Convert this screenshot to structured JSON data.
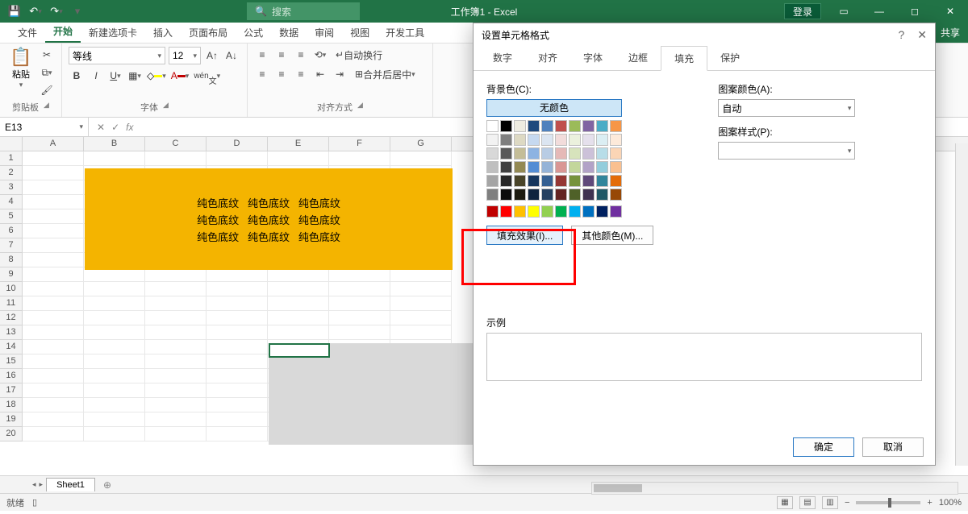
{
  "titlebar": {
    "title": "工作簿1  -  Excel",
    "search_placeholder": "搜索",
    "login": "登录"
  },
  "tabs": {
    "file": "文件",
    "home": "开始",
    "newtab": "新建选项卡",
    "insert": "插入",
    "layout": "页面布局",
    "formula": "公式",
    "data": "数据",
    "review": "审阅",
    "view": "视图",
    "dev": "开发工具",
    "share": "共享"
  },
  "ribbon": {
    "paste": "粘贴",
    "clipboard": "剪贴板",
    "font_name": "等线",
    "font_size": "12",
    "font_group": "字体",
    "wen": "wén",
    "align_group": "对齐方式",
    "wrap": "自动换行",
    "merge": "合并后居中"
  },
  "namebox": "E13",
  "columns": [
    "A",
    "B",
    "C",
    "D",
    "E",
    "F",
    "G"
  ],
  "rows_count": 20,
  "yellow_text": "纯色底纹",
  "sheet": {
    "name": "Sheet1"
  },
  "status": {
    "ready": "就绪",
    "zoom": "100%"
  },
  "dialog": {
    "title": "设置单元格格式",
    "tabs": {
      "number": "数字",
      "align": "对齐",
      "font": "字体",
      "border": "边框",
      "fill": "填充",
      "protect": "保护"
    },
    "bg_label": "背景色(C):",
    "nocolor": "无颜色",
    "fill_effect": "填充效果(I)...",
    "more_colors": "其他颜色(M)...",
    "pattern_color": "图案颜色(A):",
    "auto": "自动",
    "pattern_style": "图案样式(P):",
    "sample": "示例",
    "ok": "确定",
    "cancel": "取消"
  },
  "palette_main": [
    [
      "#ffffff",
      "#000000",
      "#eeece1",
      "#1f497d",
      "#4f81bd",
      "#c0504d",
      "#9bbb59",
      "#8064a2",
      "#4bacc6",
      "#f79646"
    ],
    [
      "#f2f2f2",
      "#7f7f7f",
      "#ddd9c3",
      "#c6d9f0",
      "#dbe5f1",
      "#f2dcdb",
      "#ebf1dd",
      "#e5e0ec",
      "#dbeef3",
      "#fdeada"
    ],
    [
      "#d8d8d8",
      "#595959",
      "#c4bd97",
      "#8db3e2",
      "#b8cce4",
      "#e5b9b7",
      "#d7e3bc",
      "#ccc1d9",
      "#b7dde8",
      "#fbd5b5"
    ],
    [
      "#bfbfbf",
      "#3f3f3f",
      "#938953",
      "#548dd4",
      "#95b3d7",
      "#d99694",
      "#c3d69b",
      "#b2a2c7",
      "#92cddc",
      "#fac08f"
    ],
    [
      "#a5a5a5",
      "#262626",
      "#494429",
      "#17365d",
      "#366092",
      "#953734",
      "#76923c",
      "#5f497a",
      "#31859b",
      "#e36c09"
    ],
    [
      "#7f7f7f",
      "#0c0c0c",
      "#1d1b10",
      "#0f243e",
      "#244061",
      "#632423",
      "#4f6128",
      "#3f3151",
      "#205867",
      "#974806"
    ]
  ],
  "palette_standard": [
    "#c00000",
    "#ff0000",
    "#ffc000",
    "#ffff00",
    "#92d050",
    "#00b050",
    "#00b0f0",
    "#0070c0",
    "#002060",
    "#7030a0"
  ]
}
